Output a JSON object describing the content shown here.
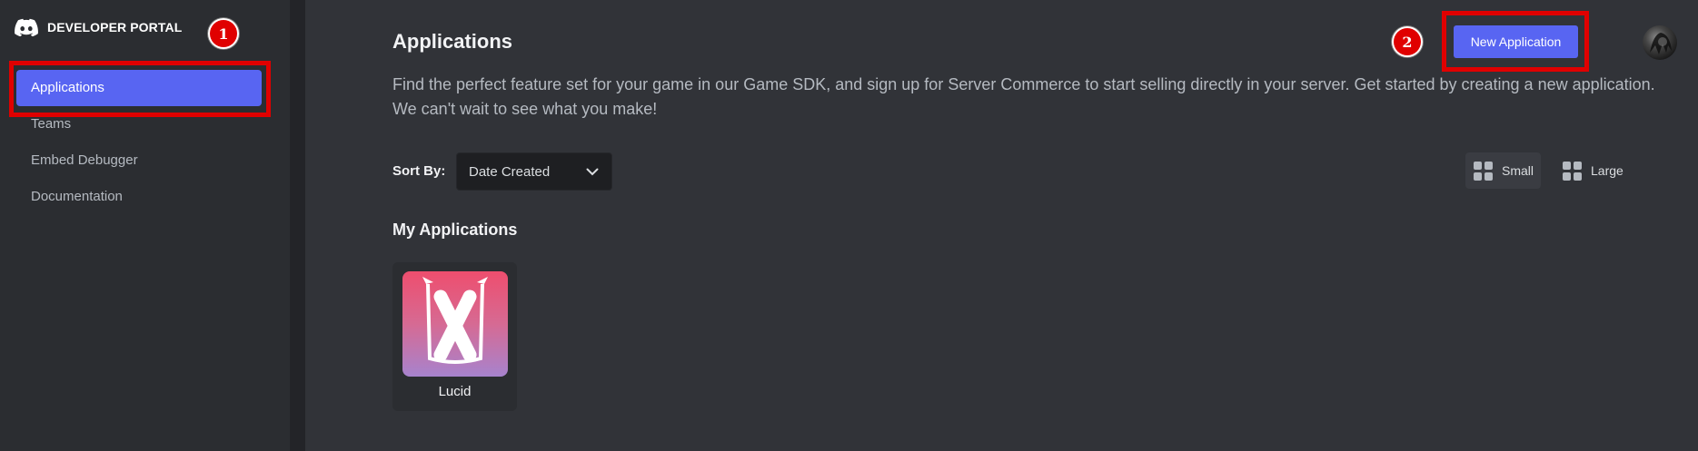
{
  "sidebar": {
    "brand_label": "DEVELOPER PORTAL",
    "items": [
      {
        "label": "Applications",
        "active": true
      },
      {
        "label": "Teams",
        "active": false
      },
      {
        "label": "Embed Debugger",
        "active": false
      },
      {
        "label": "Documentation",
        "active": false
      }
    ]
  },
  "annotations": {
    "step1": "1",
    "step2": "2"
  },
  "header": {
    "title": "Applications",
    "new_app_label": "New Application",
    "intro": "Find the perfect feature set for your game in our Game SDK, and sign up for Server Commerce to start selling directly in your server. Get started by creating a new application. We can't wait to see what you make!"
  },
  "toolbar": {
    "sort_label": "Sort By:",
    "sort_value": "Date Created",
    "view_small": "Small",
    "view_large": "Large",
    "selected_view": "Small"
  },
  "my_apps": {
    "title": "My Applications",
    "apps": [
      {
        "name": "Lucid",
        "icon": "lucid-x-icon"
      }
    ]
  },
  "colors": {
    "accent": "#5865f2",
    "annotation": "#e00000",
    "background": "#313338",
    "sidebar": "#2b2d31"
  }
}
